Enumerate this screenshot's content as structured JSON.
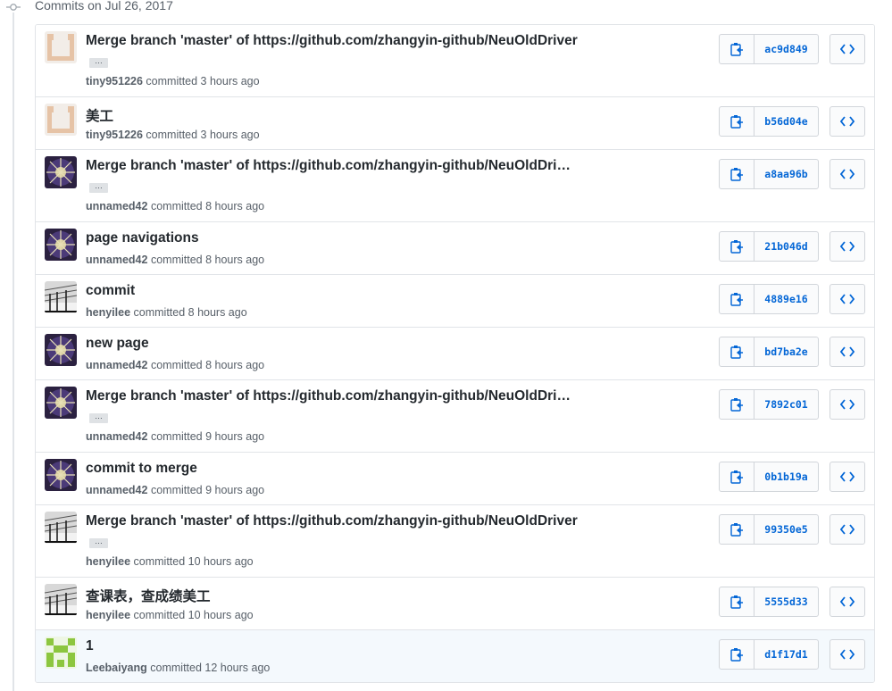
{
  "header": {
    "title": "Commits on Jul 26, 2017"
  },
  "commits": [
    {
      "message": "Merge branch 'master' of https://github.com/zhangyin-github/NeuOldDriver",
      "ellipsis": "…",
      "author": "tiny951226",
      "time": "committed 3 hours ago",
      "sha": "ac9d849",
      "avatar": "tan-identicon"
    },
    {
      "message": "美工",
      "author": "tiny951226",
      "time": "committed 3 hours ago",
      "sha": "b56d04e",
      "avatar": "tan-identicon"
    },
    {
      "message": "Merge branch 'master' of https://github.com/zhangyin-github/NeuOldDri…",
      "ellipsis": "…",
      "author": "unnamed42",
      "time": "committed 8 hours ago",
      "sha": "a8aa96b",
      "avatar": "space-photo"
    },
    {
      "message": "page navigations",
      "author": "unnamed42",
      "time": "committed 8 hours ago",
      "sha": "21b046d",
      "avatar": "space-photo"
    },
    {
      "message": "commit",
      "author": "henyilee",
      "time": "committed 8 hours ago",
      "sha": "4889e16",
      "avatar": "bridge-photo"
    },
    {
      "message": "new page",
      "author": "unnamed42",
      "time": "committed 8 hours ago",
      "sha": "bd7ba2e",
      "avatar": "space-photo"
    },
    {
      "message": "Merge branch 'master' of https://github.com/zhangyin-github/NeuOldDri…",
      "ellipsis": "…",
      "author": "unnamed42",
      "time": "committed 9 hours ago",
      "sha": "7892c01",
      "avatar": "space-photo"
    },
    {
      "message": "commit to merge",
      "author": "unnamed42",
      "time": "committed 9 hours ago",
      "sha": "0b1b19a",
      "avatar": "space-photo"
    },
    {
      "message": "Merge branch 'master' of https://github.com/zhangyin-github/NeuOldDriver",
      "ellipsis": "…",
      "author": "henyilee",
      "time": "committed 10 hours ago",
      "sha": "99350e5",
      "avatar": "bridge-photo"
    },
    {
      "message": "查课表，查成绩美工",
      "author": "henyilee",
      "time": "committed 10 hours ago",
      "sha": "5555d33",
      "avatar": "bridge-photo"
    },
    {
      "message": "1",
      "author": "Leebaiyang",
      "time": "committed 12 hours ago",
      "sha": "d1f17d1",
      "avatar": "green-identicon"
    }
  ],
  "icons": {
    "commit": "commit-icon",
    "copy": "clippy-icon",
    "browse": "code-icon"
  },
  "colors": {
    "link": "#0366d6",
    "border": "#e1e4e8",
    "muted": "#586069",
    "tan_identicon": "#e6c3a6",
    "green_identicon": "#8cc63f"
  }
}
